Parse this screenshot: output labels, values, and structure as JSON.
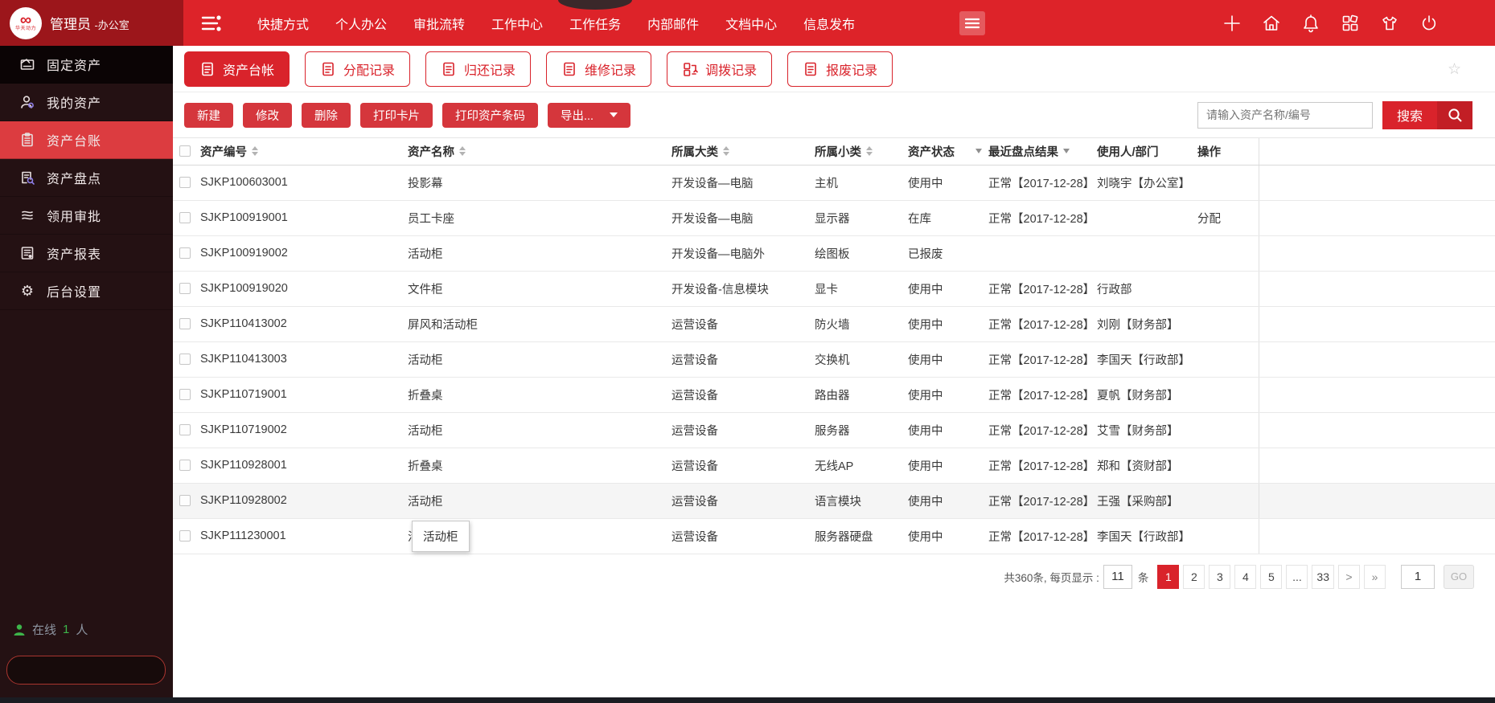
{
  "topbar": {
    "user": "管理员",
    "dept": "-办公室",
    "nav": [
      "快捷方式",
      "个人办公",
      "审批流转",
      "工作中心",
      "工作任务",
      "内部邮件",
      "文档中心",
      "信息发布"
    ],
    "right_icons": [
      "plus-icon",
      "home-icon",
      "bell-icon",
      "apps-icon",
      "theme-shirt-icon",
      "power-icon"
    ],
    "colors": {
      "bar": "#dd2329",
      "left_section": "#9c161b"
    }
  },
  "sidebar": {
    "items": [
      {
        "label": "固定资产",
        "icon": "asset-card-icon",
        "header": true
      },
      {
        "label": "我的资产",
        "icon": "my-assets-icon"
      },
      {
        "label": "资产台账",
        "icon": "ledger-icon",
        "active": true
      },
      {
        "label": "资产盘点",
        "icon": "inventory-icon"
      },
      {
        "label": "领用审批",
        "icon": "approval-icon"
      },
      {
        "label": "资产报表",
        "icon": "report-icon"
      },
      {
        "label": "后台设置",
        "icon": "settings-gear-icon"
      }
    ],
    "online": {
      "label": "在线",
      "count": "1",
      "unit": "人"
    },
    "accent": "#dc3c40"
  },
  "tabs": [
    {
      "label": "资产台帐",
      "icon": "ledger-tab-icon",
      "active": true
    },
    {
      "label": "分配记录",
      "icon": "assign-record-icon"
    },
    {
      "label": "归还记录",
      "icon": "return-record-icon"
    },
    {
      "label": "维修记录",
      "icon": "repair-record-icon"
    },
    {
      "label": "调拨记录",
      "icon": "transfer-record-icon"
    },
    {
      "label": "报废记录",
      "icon": "scrap-record-icon"
    }
  ],
  "toolbar": {
    "buttons": [
      "新建",
      "修改",
      "删除",
      "打印卡片",
      "打印资产条码"
    ],
    "export_label": "导出...",
    "search_placeholder": "请输入资产名称/编号",
    "search_button": "搜索"
  },
  "table": {
    "columns": [
      {
        "label": "资产编号",
        "key": "code",
        "sort": true
      },
      {
        "label": "资产名称",
        "key": "name",
        "sort": true
      },
      {
        "label": "所属大类",
        "key": "category",
        "sort": true
      },
      {
        "label": "所属小类",
        "key": "subcategory",
        "sort": true
      },
      {
        "label": "资产状态",
        "key": "status",
        "filter": true
      },
      {
        "label": "最近盘点结果",
        "key": "check",
        "filter": true,
        "tight": true
      },
      {
        "label": "使用人/部门",
        "key": "user"
      },
      {
        "label": "操作",
        "key": "op"
      }
    ],
    "rows": [
      {
        "code": "SJKP100603001",
        "name": "投影幕",
        "category": "开发设备—电脑",
        "subcategory": "主机",
        "status": "使用中",
        "check": "正常【2017-12-28】",
        "user": "刘晓宇【办公室】",
        "op": ""
      },
      {
        "code": "SJKP100919001",
        "name": "员工卡座",
        "category": "开发设备—电脑",
        "subcategory": "显示器",
        "status": "在库",
        "check": "正常【2017-12-28】",
        "user": "",
        "op": "分配"
      },
      {
        "code": "SJKP100919002",
        "name": "活动柜",
        "category": "开发设备—电脑外",
        "subcategory": "绘图板",
        "status": "已报废",
        "check": "",
        "user": "",
        "op": ""
      },
      {
        "code": "SJKP100919020",
        "name": "文件柜",
        "category": "开发设备-信息模块",
        "subcategory": "显卡",
        "status": "使用中",
        "check": "正常【2017-12-28】",
        "user": "行政部",
        "op": ""
      },
      {
        "code": "SJKP110413002",
        "name": "屏风和活动柜",
        "category": "运营设备",
        "subcategory": "防火墙",
        "status": "使用中",
        "check": "正常【2017-12-28】",
        "user": "刘刚【财务部】",
        "op": ""
      },
      {
        "code": "SJKP110413003",
        "name": "活动柜",
        "category": "运营设备",
        "subcategory": "交换机",
        "status": "使用中",
        "check": "正常【2017-12-28】",
        "user": "李国天【行政部】",
        "op": ""
      },
      {
        "code": "SJKP110719001",
        "name": "折叠桌",
        "category": "运营设备",
        "subcategory": "路由器",
        "status": "使用中",
        "check": "正常【2017-12-28】",
        "user": "夏帆【财务部】",
        "op": ""
      },
      {
        "code": "SJKP110719002",
        "name": "活动柜",
        "category": "运营设备",
        "subcategory": "服务器",
        "status": "使用中",
        "check": "正常【2017-12-28】",
        "user": "艾雪【财务部】",
        "op": ""
      },
      {
        "code": "SJKP110928001",
        "name": "折叠桌",
        "category": "运营设备",
        "subcategory": "无线AP",
        "status": "使用中",
        "check": "正常【2017-12-28】",
        "user": "郑和【资财部】",
        "op": ""
      },
      {
        "code": "SJKP110928002",
        "name": "活动柜",
        "category": "运营设备",
        "subcategory": "语言模块",
        "status": "使用中",
        "check": "正常【2017-12-28】",
        "user": "王强【采购部】",
        "op": "",
        "highlight": true
      },
      {
        "code": "SJKP111230001",
        "name": "活动柜",
        "category": "运营设备",
        "subcategory": "服务器硬盘",
        "status": "使用中",
        "check": "正常【2017-12-28】",
        "user": "李国天【行政部】",
        "op": ""
      }
    ]
  },
  "tooltip": {
    "text": "活动柜"
  },
  "pagination": {
    "summary": "共360条, 每页显示 :",
    "page_size": "11",
    "unit": "条",
    "pages": [
      "1",
      "2",
      "3",
      "4",
      "5",
      "...",
      "33"
    ],
    "active_page": "1",
    "next": ">",
    "last": "»",
    "jump_value": "1",
    "go_label": "GO"
  }
}
